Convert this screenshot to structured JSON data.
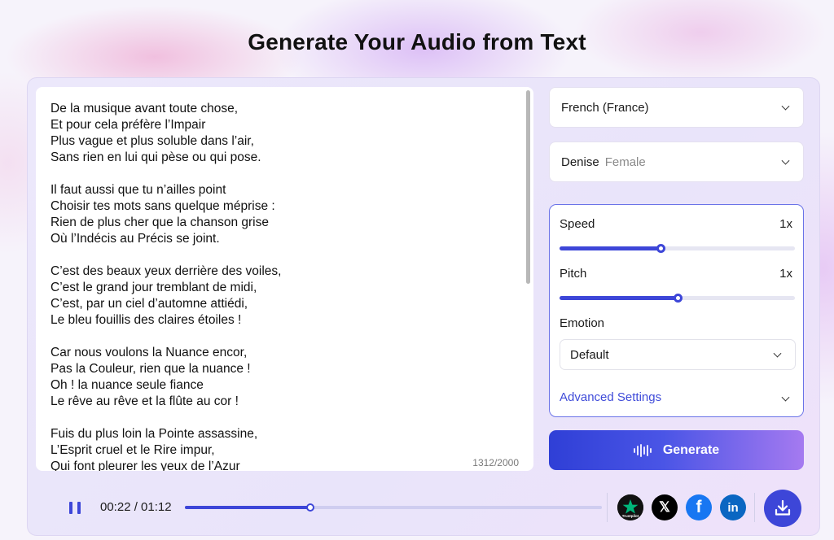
{
  "header": {
    "title": "Generate Your Audio from Text"
  },
  "editor": {
    "text": "De la musique avant toute chose,\nEt pour cela préfère l’Impair\nPlus vague et plus soluble dans l’air,\nSans rien en lui qui pèse ou qui pose.\n\nIl faut aussi que tu n’ailles point\nChoisir tes mots sans quelque méprise :\nRien de plus cher que la chanson grise\nOù l’Indécis au Précis se joint.\n\nC’est des beaux yeux derrière des voiles,\nC’est le grand jour tremblant de midi,\nC’est, par un ciel d’automne attiédi,\nLe bleu fouillis des claires étoiles !\n\nCar nous voulons la Nuance encor,\nPas la Couleur, rien que la nuance !\nOh ! la nuance seule fiance\nLe rêve au rêve et la flûte au cor !\n\nFuis du plus loin la Pointe assassine,\nL’Esprit cruel et le Rire impur,\nQui font pleurer les yeux de l’Azur",
    "char_count": "1312/2000"
  },
  "language": {
    "selected": "French (France)"
  },
  "voice": {
    "name": "Denise",
    "gender": "Female"
  },
  "settings": {
    "speed": {
      "label": "Speed",
      "value": "1x",
      "level": 0.43
    },
    "pitch": {
      "label": "Pitch",
      "value": "1x",
      "level": 0.5
    },
    "emotion": {
      "label": "Emotion",
      "selected": "Default"
    },
    "advanced_label": "Advanced Settings"
  },
  "generate": {
    "label": "Generate"
  },
  "player": {
    "time": "00:22 / 01:12",
    "progress": 0.3
  },
  "social": {
    "trustpilot_label": "Trustpilot",
    "x_glyph": "𝕏",
    "facebook_glyph": "f",
    "linkedin_glyph": "in"
  },
  "colors": {
    "accent": "#3d46d8",
    "link": "#3f4bd9",
    "facebook": "#1877f2",
    "linkedin": "#0a66c2"
  }
}
